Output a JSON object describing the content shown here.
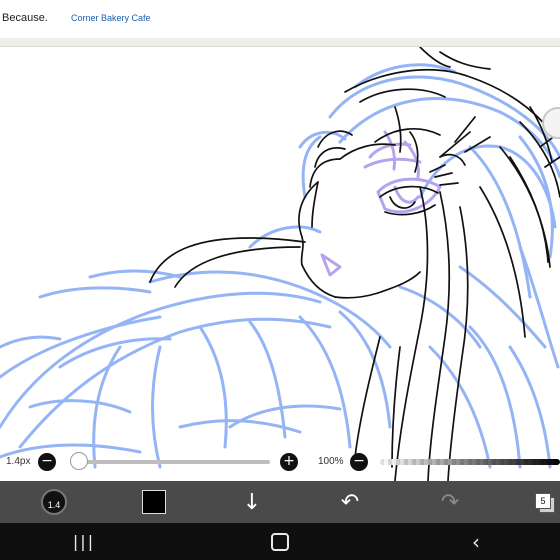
{
  "ad": {
    "text1": "Because.",
    "text2": "Corner Bakery Cafe"
  },
  "brush_size_slider": {
    "label": "1.4px",
    "value_fraction": 0.0
  },
  "opacity_slider": {
    "label": "100%",
    "value_fraction": 1.0
  },
  "toolbar": {
    "brush_size_value": "1.4",
    "color_hex": "#000000",
    "layers_count": "5"
  },
  "colors": {
    "sketch_blue": "#8fb0f5",
    "sketch_purple": "#b6a3ee",
    "lineart": "#111111",
    "toolbar_bg": "#4a4a4a",
    "navbar_bg": "#0f0f0f"
  },
  "icons": {
    "brush_size": "circle-icon",
    "color": "square-swatch-icon",
    "download": "arrow-down-icon",
    "undo": "undo-icon",
    "redo": "redo-icon",
    "layers": "layers-icon",
    "nav_recent": "recent-apps-icon",
    "nav_home": "home-icon",
    "nav_back": "back-icon"
  }
}
